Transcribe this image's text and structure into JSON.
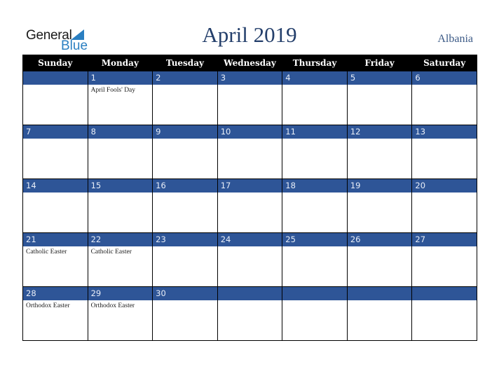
{
  "logo": {
    "line1": "General",
    "line2": "Blue",
    "accent_color": "#2a7fc1"
  },
  "header": {
    "title": "April 2019",
    "country": "Albania"
  },
  "colors": {
    "header_bg": "#000000",
    "date_band": "#2e5597",
    "title": "#243f6b"
  },
  "weekdays": [
    "Sunday",
    "Monday",
    "Tuesday",
    "Wednesday",
    "Thursday",
    "Friday",
    "Saturday"
  ],
  "weeks": [
    [
      {
        "day": "",
        "holiday": ""
      },
      {
        "day": "1",
        "holiday": "April Fools' Day"
      },
      {
        "day": "2",
        "holiday": ""
      },
      {
        "day": "3",
        "holiday": ""
      },
      {
        "day": "4",
        "holiday": ""
      },
      {
        "day": "5",
        "holiday": ""
      },
      {
        "day": "6",
        "holiday": ""
      }
    ],
    [
      {
        "day": "7",
        "holiday": ""
      },
      {
        "day": "8",
        "holiday": ""
      },
      {
        "day": "9",
        "holiday": ""
      },
      {
        "day": "10",
        "holiday": ""
      },
      {
        "day": "11",
        "holiday": ""
      },
      {
        "day": "12",
        "holiday": ""
      },
      {
        "day": "13",
        "holiday": ""
      }
    ],
    [
      {
        "day": "14",
        "holiday": ""
      },
      {
        "day": "15",
        "holiday": ""
      },
      {
        "day": "16",
        "holiday": ""
      },
      {
        "day": "17",
        "holiday": ""
      },
      {
        "day": "18",
        "holiday": ""
      },
      {
        "day": "19",
        "holiday": ""
      },
      {
        "day": "20",
        "holiday": ""
      }
    ],
    [
      {
        "day": "21",
        "holiday": "Catholic Easter"
      },
      {
        "day": "22",
        "holiday": "Catholic Easter"
      },
      {
        "day": "23",
        "holiday": ""
      },
      {
        "day": "24",
        "holiday": ""
      },
      {
        "day": "25",
        "holiday": ""
      },
      {
        "day": "26",
        "holiday": ""
      },
      {
        "day": "27",
        "holiday": ""
      }
    ],
    [
      {
        "day": "28",
        "holiday": "Orthodox Easter"
      },
      {
        "day": "29",
        "holiday": "Orthodox Easter"
      },
      {
        "day": "30",
        "holiday": ""
      },
      {
        "day": "",
        "holiday": ""
      },
      {
        "day": "",
        "holiday": ""
      },
      {
        "day": "",
        "holiday": ""
      },
      {
        "day": "",
        "holiday": ""
      }
    ]
  ]
}
